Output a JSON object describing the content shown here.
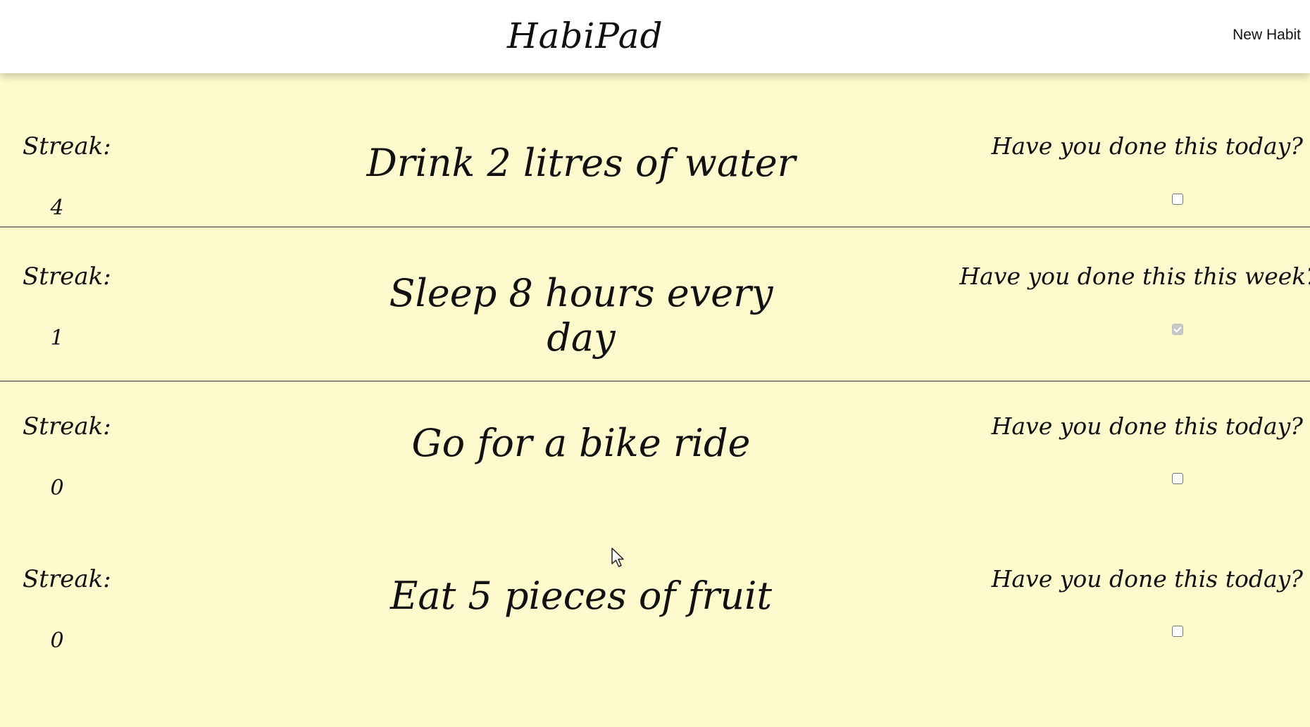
{
  "header": {
    "brand": "HabiPad",
    "new_habit_label": "New Habit"
  },
  "habits": [
    {
      "streak_label": "Streak:",
      "streak": "4",
      "name": "Drink 2 litres of water",
      "question": "Have you done this today?",
      "checked": false
    },
    {
      "streak_label": "Streak:",
      "streak": "1",
      "name": "Sleep 8 hours every day",
      "question": "Have you done this this week?",
      "checked": true
    },
    {
      "streak_label": "Streak:",
      "streak": "0",
      "name": "Go for a bike ride",
      "question": "Have you done this today?",
      "checked": false
    },
    {
      "streak_label": "Streak:",
      "streak": "0",
      "name": "Eat 5 pieces of fruit",
      "question": "Have you done this today?",
      "checked": false
    }
  ],
  "colors": {
    "background": "#fffacd",
    "header": "#ffffff",
    "text": "#111111"
  }
}
